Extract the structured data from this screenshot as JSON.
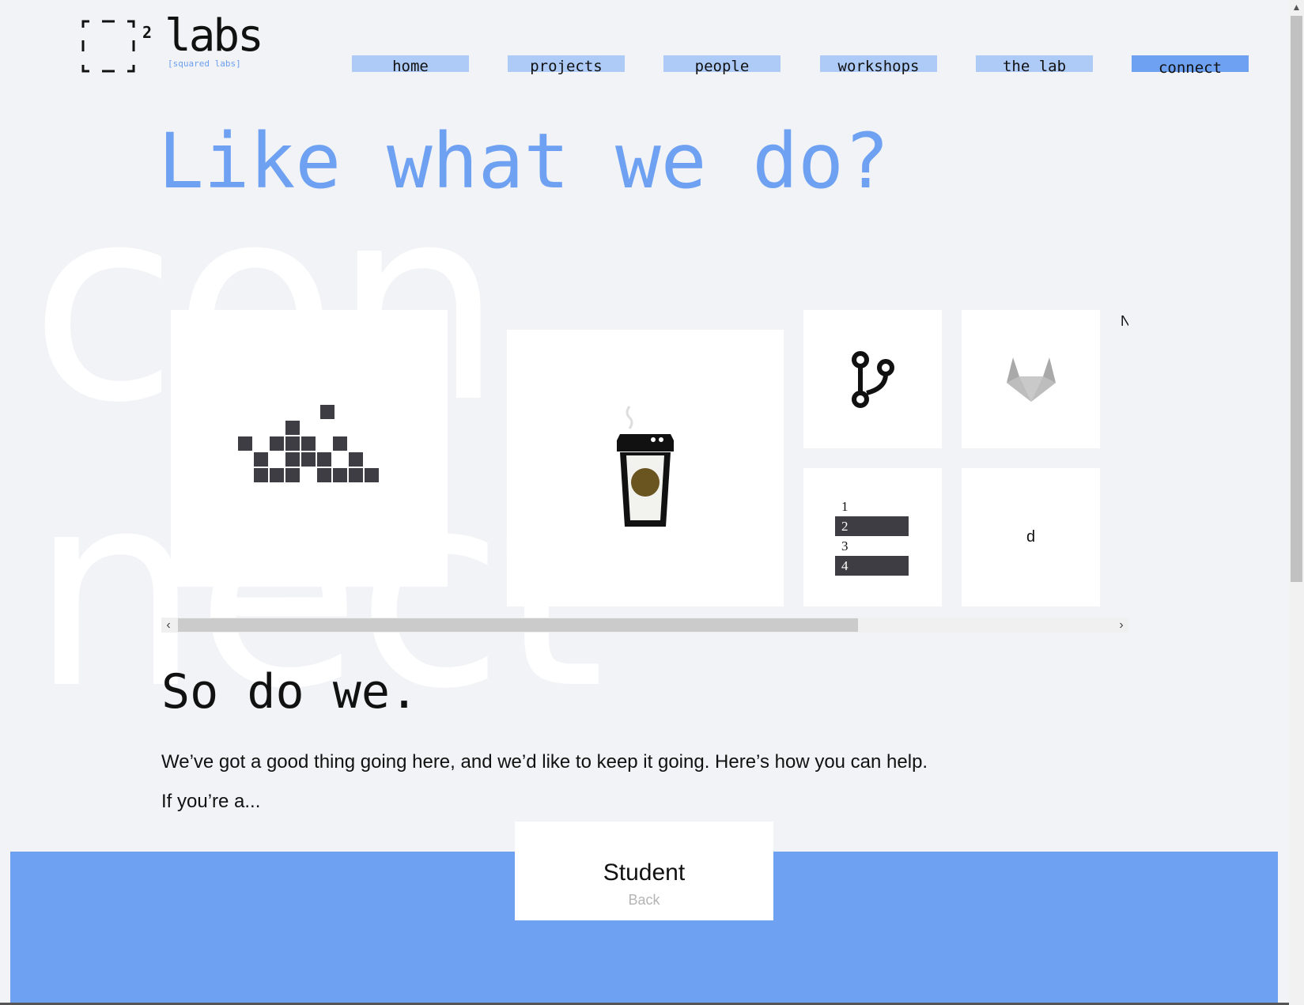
{
  "watermark": "connect",
  "logo": {
    "superscript": "2",
    "word": "labs",
    "tagline": "[squared labs]"
  },
  "nav": {
    "items": [
      {
        "label": "home"
      },
      {
        "label": "projects"
      },
      {
        "label": "people"
      },
      {
        "label": "workshops"
      },
      {
        "label": "the lab"
      },
      {
        "label": "connect",
        "active": true
      }
    ]
  },
  "headline": "Like what we do?",
  "carousel": {
    "cards": [
      {
        "icon": "pixel-blocks-icon"
      },
      {
        "icon": "coffee-cup-icon"
      },
      {
        "icon": "git-branch-icon"
      },
      {
        "icon": "gitlab-fox-icon"
      },
      {
        "icon": "numbered-list-icon",
        "list": [
          "1",
          "2",
          "3",
          "4"
        ]
      },
      {
        "text": "d"
      }
    ],
    "clipped_text": "N",
    "scroll_left": "‹",
    "scroll_right": "›"
  },
  "section": {
    "title": "So do we.",
    "paragraph": "We’ve got a good thing going here, and we’d like to keep it going. Here’s how you can help.",
    "lead": "If you’re a..."
  },
  "student_card": {
    "title": "Student",
    "subtitle": "Back"
  },
  "colors": {
    "accent": "#6ea1f2",
    "nav_bg": "#aecaf6",
    "page_bg": "#f2f3f6",
    "dark_tile": "#3e3d43"
  }
}
